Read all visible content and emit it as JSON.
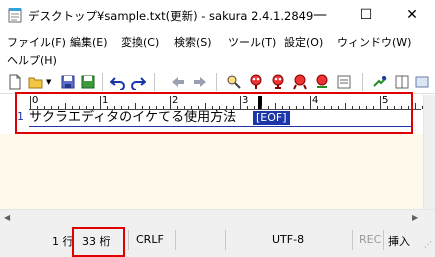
{
  "window": {
    "title": "デスクトップ¥sample.txt(更新) - sakura 2.4.1.2849",
    "min_glyph": "—",
    "max_glyph": "☐",
    "close_glyph": "✕"
  },
  "menu": {
    "items": [
      "ファイル(F)",
      "編集(E)",
      "変換(C)",
      "検索(S)",
      "ツール(T)",
      "設定(O)",
      "ウィンドウ(W)",
      "ヘルプ(H)"
    ]
  },
  "ruler": {
    "labels": [
      "0",
      "1",
      "2",
      "3",
      "4",
      "5"
    ]
  },
  "editor": {
    "line_number": "1",
    "line_text": "サクラエディタのイケてる使用方法",
    "eof_marker": "[EOF]"
  },
  "status": {
    "line": "1 行",
    "column": "33 桁",
    "newline": "CRLF",
    "encoding": "UTF-8",
    "rec": "REC",
    "insert_mode": "挿入"
  },
  "colors": {
    "accent": "#1a36a8",
    "editor_bg": "#fff9ec",
    "highlight": "#e00000"
  },
  "icons": [
    "new-file-icon",
    "open-folder-icon",
    "save-icon",
    "save-all-icon",
    "undo-icon",
    "redo-icon",
    "jump-back-icon",
    "jump-forward-icon",
    "search-prev-icon",
    "search-next-icon",
    "search-icon",
    "grep-icon",
    "replace-icon",
    "compare-icon",
    "outline-icon"
  ]
}
